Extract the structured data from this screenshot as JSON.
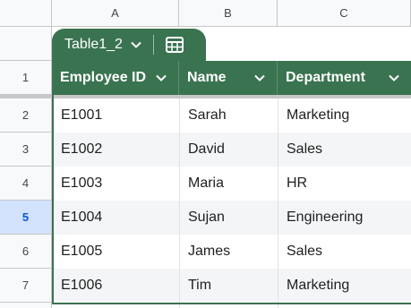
{
  "columns": [
    "A",
    "B",
    "C"
  ],
  "rows": [
    "1",
    "2",
    "3",
    "4",
    "5",
    "6",
    "7"
  ],
  "table": {
    "name": "Table1_2",
    "headers": [
      "Employee ID",
      "Name",
      "Department"
    ],
    "data": [
      [
        "E1001",
        "Sarah",
        "Marketing"
      ],
      [
        "E1002",
        "David",
        "Sales"
      ],
      [
        "E1003",
        "Maria",
        "HR"
      ],
      [
        "E1004",
        "Sujan",
        "Engineering"
      ],
      [
        "E1005",
        "James",
        "Sales"
      ],
      [
        "E1006",
        "Tim",
        "Marketing"
      ]
    ]
  },
  "active_row": "5",
  "colors": {
    "table_header": "#3a7350",
    "active_row_bg": "#d3e3fd",
    "active_row_text": "#0b57d0"
  },
  "icons": {
    "tab_menu": "chevron-down-icon",
    "table_icon": "table-grid-icon",
    "column_menu": "chevron-down-icon"
  }
}
